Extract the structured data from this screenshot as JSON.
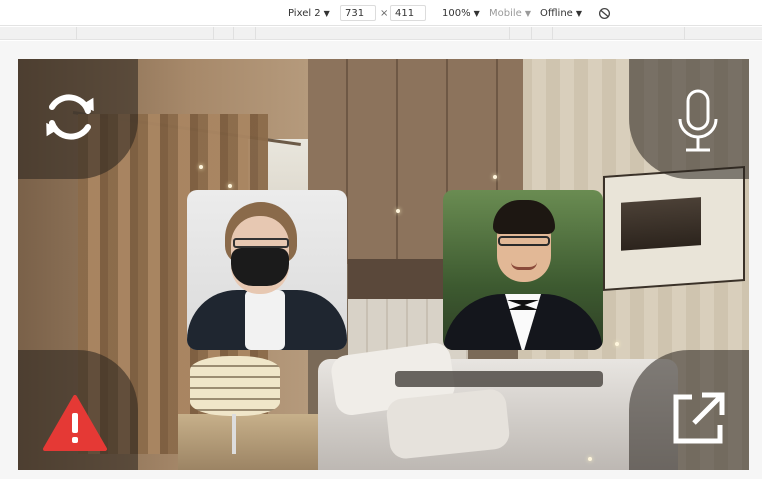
{
  "devtools": {
    "device": "Pixel 2",
    "width": "731",
    "times": "×",
    "height": "411",
    "zoom": "100%",
    "mode": "Mobile",
    "network": "Offline",
    "caret": "▼",
    "rotate_icon": "rotate-icon"
  },
  "call": {
    "participants": [
      "participant-masked",
      "participant-tuxedo"
    ],
    "icons": {
      "top_left": "switch-camera-icon",
      "top_right": "microphone-icon",
      "bottom_left": "warning-icon",
      "bottom_right": "open-external-icon"
    },
    "colors": {
      "icon": "#ffffff",
      "warning": "#e53935",
      "corner_overlay": "rgba(40,35,30,0.55)"
    }
  }
}
